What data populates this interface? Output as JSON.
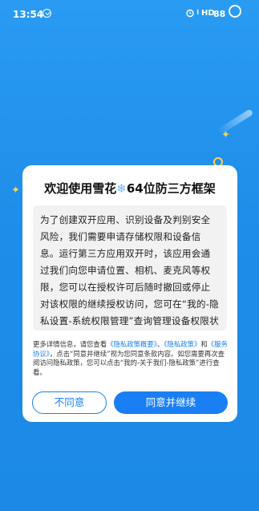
{
  "status_bar": {
    "time": "13:54",
    "network": "HD",
    "battery": "88"
  },
  "dialog": {
    "title_prefix": "欢迎使用雪花",
    "title_icon": "❄",
    "title_suffix": "64位防三方框架",
    "notice": "为了创建双开应用、识别设备及判别安全风险，我们需要申请存储权限和设备信息。运行第三方应用双开时，该应用会通过我们向您申请位置、相机、麦克风等权限，您可以在授权许可后随时撤回或停止对该权限的继续授权访问，您可在“我的-隐私设置-系统权限管理”查询管理设备权限状态及撤回您授权。您理解并同意，在您使用我们服务时，",
    "fine_print": {
      "p1": "更多详情信息，请您查看",
      "link1": "《隐私政策概要》",
      "p2": "、",
      "link2": "《隐私政策》",
      "p3": "和",
      "link3": "《服务协议》",
      "p4": "，点击“同意并继续”视为您同意条款内容。如您需要再次查阅访问隐私政策，您可以点击“我的-关于我们-隐私政策”进行查看。"
    },
    "disagree_label": "不同意",
    "agree_label": "同意并继续"
  },
  "colors": {
    "accent": "#1a7ff5",
    "background": "#1d8de9"
  }
}
